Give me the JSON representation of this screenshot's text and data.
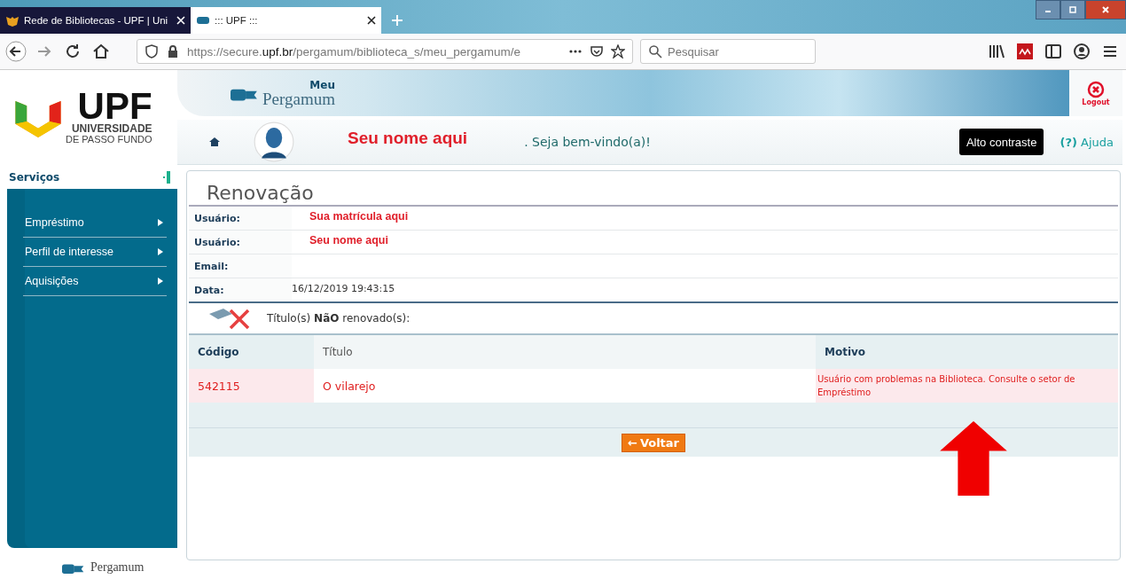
{
  "browser": {
    "tabs": [
      {
        "title": "Rede de Bibliotecas - UPF | Uni",
        "selected": false
      },
      {
        "title": "::: UPF :::",
        "selected": true
      }
    ],
    "url": {
      "prefix": "https://secure.",
      "domain": "upf.br",
      "path": "/pergamum/biblioteca_s/meu_pergamum/e"
    },
    "search": {
      "placeholder": "Pesquisar"
    }
  },
  "logo": {
    "name": "UPF",
    "line1": "UNIVERSIDADE",
    "line2": "DE PASSO FUNDO"
  },
  "header": {
    "brand_top": "Meu",
    "brand": "Pergamum",
    "logout": "Logout"
  },
  "userbar": {
    "name": "Seu nome aqui",
    "welcome": ". Seja bem-vindo(a)!",
    "contrast": "Alto contraste",
    "help_mark": "(?)",
    "help": "Ajuda"
  },
  "sidebar": {
    "heading": "Serviços",
    "items": [
      {
        "label": "Empréstimo"
      },
      {
        "label": "Perfil de interesse"
      },
      {
        "label": "Aquisições"
      }
    ],
    "footer": "Pergamum"
  },
  "content": {
    "title": "Renovação",
    "info": [
      {
        "label": "Usuário:",
        "value": "Sua matrícula aqui",
        "kind": "entered"
      },
      {
        "label": "Usuário:",
        "value": "Seu nome aqui",
        "kind": "entered"
      },
      {
        "label": "Email:"
      },
      {
        "label": "Data:",
        "value": "16/12/2019 19:43:15",
        "kind": "plain"
      }
    ],
    "notice": "Título(s) **NãO** renovado(s):",
    "table": {
      "columns": [
        "Código",
        "Título",
        "Motivo"
      ],
      "rows": [
        {
          "cells": [
            "542115",
            "O vilarejo",
            "Usuário com problemas na Biblioteca. Consulte o setor de Empréstimo"
          ]
        }
      ]
    },
    "button": {
      "icon": "←",
      "label": "Voltar"
    }
  }
}
